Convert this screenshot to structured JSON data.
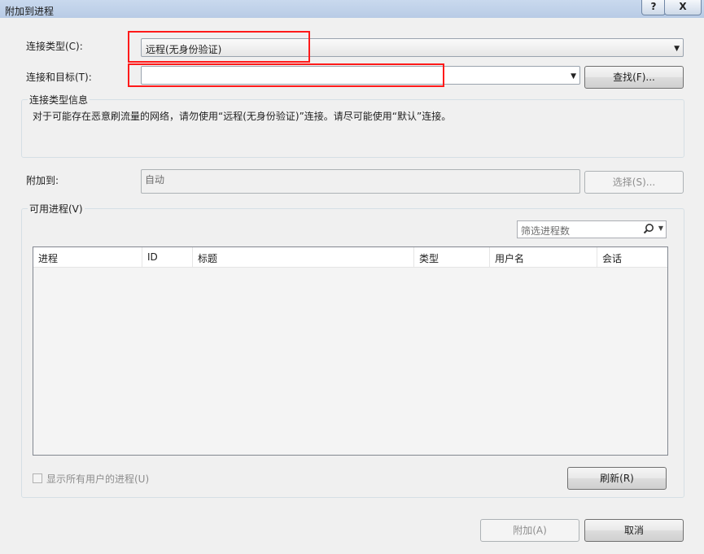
{
  "window": {
    "title": "附加到进程",
    "help_label": "?",
    "close_label": "X"
  },
  "connection_type": {
    "label": "连接类型(C):",
    "value": "远程(无身份验证)"
  },
  "connection_target": {
    "label": "连接和目标(T):",
    "value": "",
    "find_button": "查找(F)..."
  },
  "connection_info": {
    "title": "连接类型信息",
    "text": "对于可能存在恶意刷流量的网络，请勿使用“远程(无身份验证)”连接。请尽可能使用“默认”连接。"
  },
  "attach_to": {
    "label": "附加到:",
    "value": "自动",
    "select_button": "选择(S)..."
  },
  "processes": {
    "title": "可用进程(V)",
    "filter_placeholder": "筛选进程数",
    "columns": [
      "进程",
      "ID",
      "标题",
      "类型",
      "用户名",
      "会话"
    ],
    "rows": [],
    "show_all_label": "显示所有用户的进程(U)",
    "show_all_checked": false,
    "refresh_button": "刷新(R)"
  },
  "footer": {
    "attach_button": "附加(A)",
    "cancel_button": "取消"
  },
  "colors": {
    "highlight": "#ff1a1a",
    "titlebar": "#b8cbe5"
  },
  "icons": {
    "filter": "search-icon",
    "dropdown": "chevron-down-icon"
  }
}
